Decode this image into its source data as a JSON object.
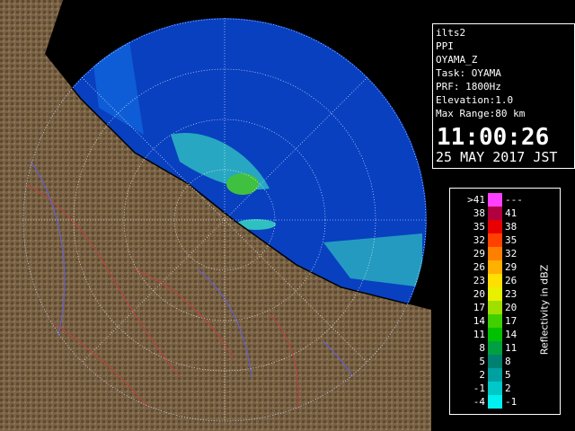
{
  "info": {
    "lines": [
      "ilts2",
      "PPI",
      "OYAMA_Z",
      "Task: OYAMA",
      "PRF: 1800Hz",
      "Elevation:1.0",
      "Max Range:80 km"
    ],
    "time": "11:00:26",
    "date": "25 MAY 2017 JST"
  },
  "legend": {
    "title": "Reflectivity in dBZ",
    "rows": [
      {
        "lo": ">41",
        "hi": "---",
        "color": "#ff40ff"
      },
      {
        "lo": "38",
        "hi": "41",
        "color": "#b00040"
      },
      {
        "lo": "35",
        "hi": "38",
        "color": "#e80000"
      },
      {
        "lo": "32",
        "hi": "35",
        "color": "#ff4000"
      },
      {
        "lo": "29",
        "hi": "32",
        "color": "#ff8000"
      },
      {
        "lo": "26",
        "hi": "29",
        "color": "#ffb000"
      },
      {
        "lo": "23",
        "hi": "26",
        "color": "#ffe000"
      },
      {
        "lo": "20",
        "hi": "23",
        "color": "#e8f000"
      },
      {
        "lo": "17",
        "hi": "20",
        "color": "#a0e000"
      },
      {
        "lo": "14",
        "hi": "17",
        "color": "#40d000"
      },
      {
        "lo": "11",
        "hi": "14",
        "color": "#00c000"
      },
      {
        "lo": "8",
        "hi": "11",
        "color": "#00a040"
      },
      {
        "lo": "5",
        "hi": "8",
        "color": "#008070"
      },
      {
        "lo": "2",
        "hi": "5",
        "color": "#00a0a0"
      },
      {
        "lo": "-1",
        "hi": "2",
        "color": "#00c8c8"
      },
      {
        "lo": "-4",
        "hi": "-1",
        "color": "#00f0f0"
      }
    ]
  },
  "colors": {
    "sea": "#0840c0",
    "echo_light": "#30c0c0",
    "echo_green": "#40c040",
    "land": "#7a6244",
    "range_circle": "#ffffff",
    "coast": "#000000"
  }
}
